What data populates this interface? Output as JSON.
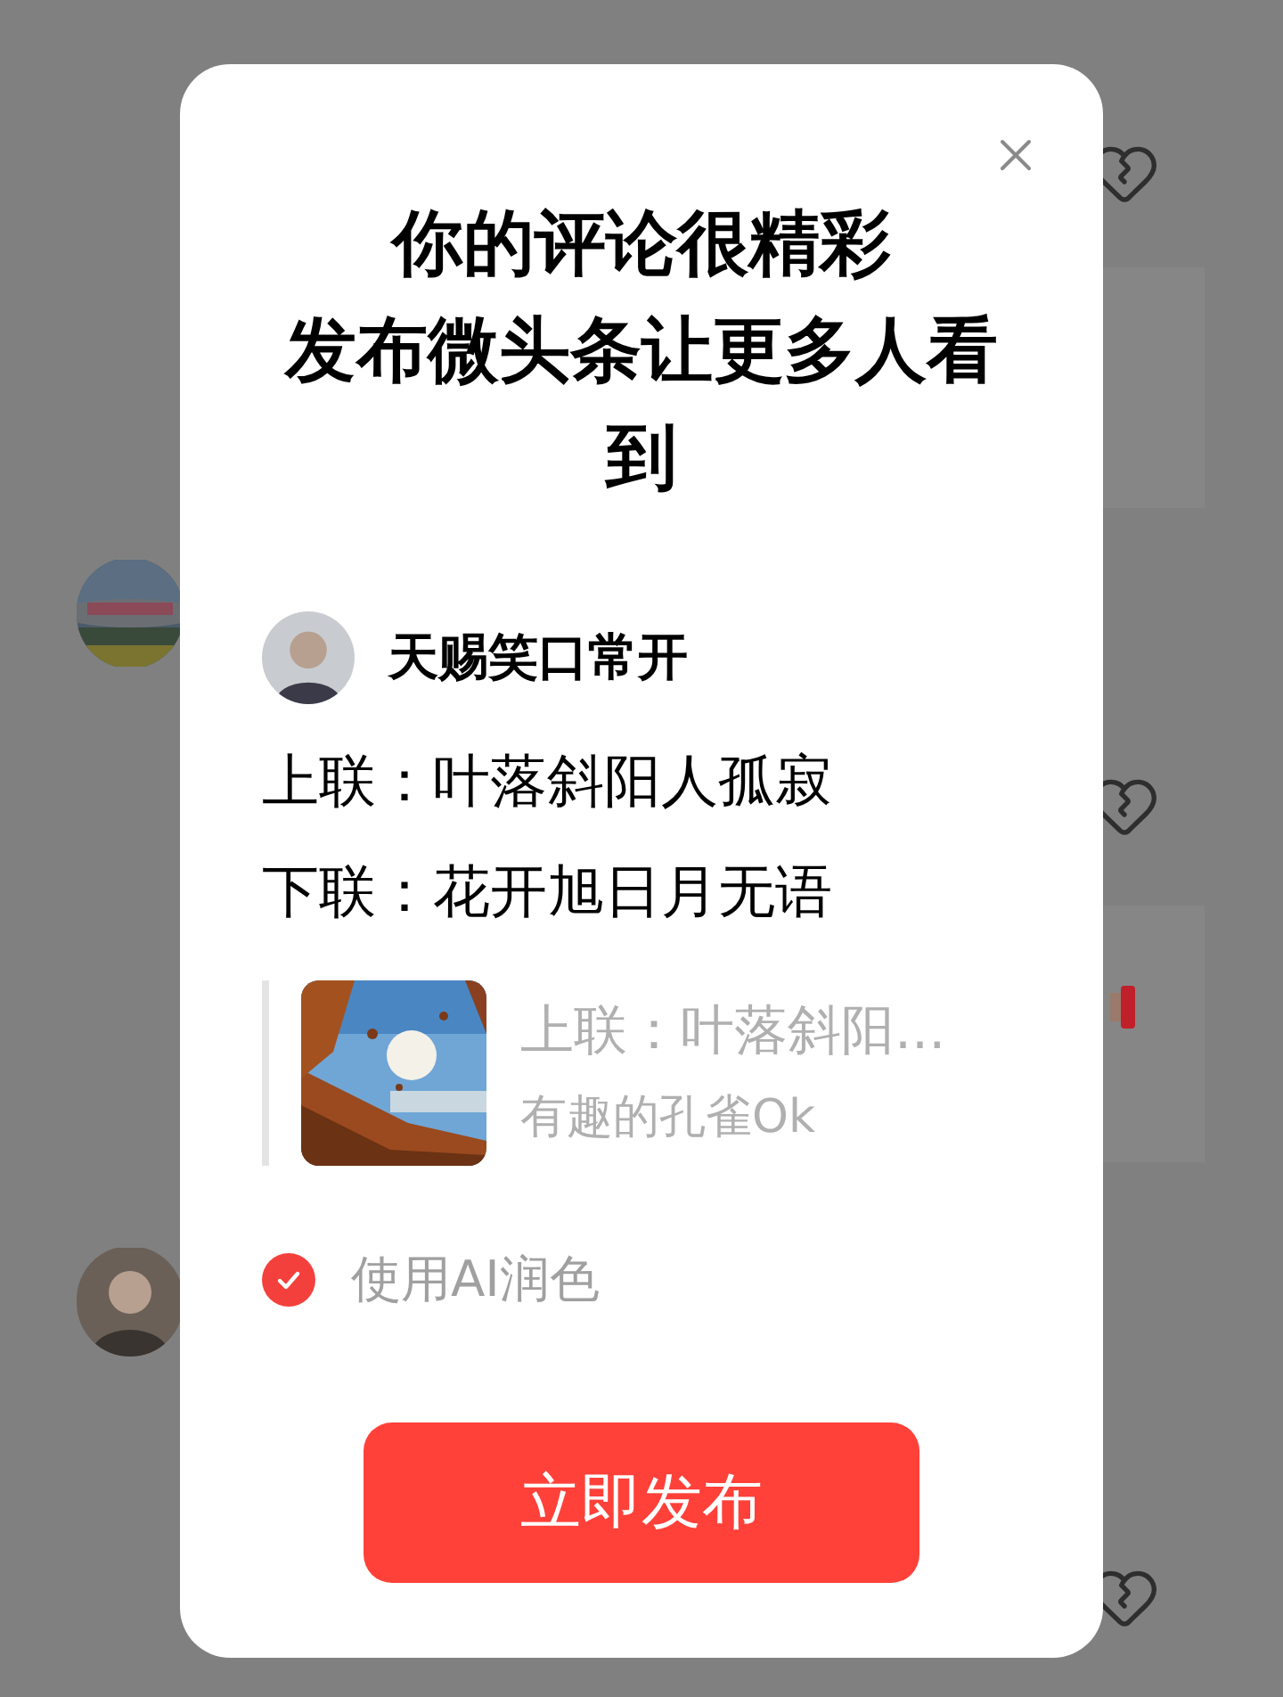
{
  "dialog": {
    "title_lines": [
      "你的评论很精彩",
      "发布微头条让更多人看到"
    ],
    "author": "天赐笑口常开",
    "lines": [
      "上联：叶落斜阳人孤寂",
      "下联：花开旭日月无语"
    ],
    "quote": {
      "title": "上联：叶落斜阳...",
      "author": "有趣的孔雀Ok"
    },
    "ai_option": {
      "label": "使用AI润色",
      "checked": true
    },
    "button": "立即发布"
  }
}
